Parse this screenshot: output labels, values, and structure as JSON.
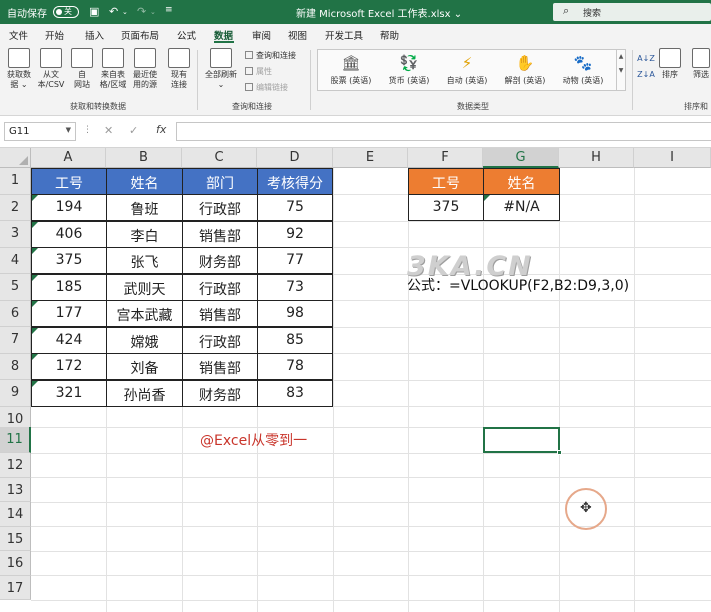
{
  "titlebar": {
    "autosave_label": "自动保存",
    "autosave_state": "关",
    "document_title": "新建 Microsoft Excel 工作表.xlsx ⌄",
    "search_placeholder": "搜索"
  },
  "menu": {
    "tabs": [
      "文件",
      "开始",
      "插入",
      "页面布局",
      "公式",
      "数据",
      "审阅",
      "视图",
      "开发工具",
      "帮助"
    ],
    "active": "数据"
  },
  "ribbon": {
    "get_data": {
      "line1": "获取数",
      "line2": "据 ⌄"
    },
    "from_csv": {
      "line1": "从文",
      "line2": "本/CSV"
    },
    "from_web": {
      "line1": "自",
      "line2": "网站"
    },
    "from_table": {
      "line1": "来自表",
      "line2": "格/区域"
    },
    "recent_sources": {
      "line1": "最近使",
      "line2": "用的源"
    },
    "existing_conn": {
      "line1": "现有",
      "line2": "连接"
    },
    "group1_name": "获取和转换数据",
    "refresh_all": {
      "line1": "全部刷新",
      "line2": "⌄"
    },
    "queries_connections": "查询和连接",
    "properties": "属性",
    "edit_links": "编辑链接",
    "group2_name": "查询和连接",
    "data_types": [
      {
        "label": "股票 (英语)",
        "icon": "bank-icon"
      },
      {
        "label": "货币 (英语)",
        "icon": "currency-icon"
      },
      {
        "label": "自动 (英语)",
        "icon": "lightning-icon"
      },
      {
        "label": "解剖 (英语)",
        "icon": "hand-icon"
      },
      {
        "label": "动物 (英语)",
        "icon": "paw-icon"
      }
    ],
    "group3_name": "数据类型",
    "sort_label": "排序",
    "filter_label": "筛选",
    "group4_name": "排序和"
  },
  "formula_bar": {
    "name_box": "G11",
    "formula": ""
  },
  "columns": [
    "A",
    "B",
    "C",
    "D",
    "E",
    "F",
    "G",
    "H",
    "I"
  ],
  "rows": [
    "1",
    "2",
    "3",
    "4",
    "5",
    "6",
    "7",
    "8",
    "9",
    "10",
    "11",
    "12",
    "13",
    "14",
    "15",
    "16",
    "17"
  ],
  "table": {
    "headers": [
      "工号",
      "姓名",
      "部门",
      "考核得分"
    ],
    "rows": [
      [
        "194",
        "鲁班",
        "行政部",
        "75"
      ],
      [
        "406",
        "李白",
        "销售部",
        "92"
      ],
      [
        "375",
        "张飞",
        "财务部",
        "77"
      ],
      [
        "185",
        "武则天",
        "行政部",
        "73"
      ],
      [
        "177",
        "宫本武藏",
        "销售部",
        "98"
      ],
      [
        "424",
        "嫦娥",
        "行政部",
        "85"
      ],
      [
        "172",
        "刘备",
        "销售部",
        "78"
      ],
      [
        "321",
        "孙尚香",
        "财务部",
        "83"
      ]
    ]
  },
  "lookup": {
    "headers": [
      "工号",
      "姓名"
    ],
    "values": [
      "375",
      "#N/A"
    ]
  },
  "formula_note": "公式：=VLOOKUP(F2,B2:D9,3,0)",
  "credit": "@Excel从零到一",
  "watermark": "3KA.CN",
  "colors": {
    "excel_green": "#217346",
    "header_blue": "#4472c4",
    "header_orange": "#ed7d31",
    "credit_red": "#c9352b"
  }
}
